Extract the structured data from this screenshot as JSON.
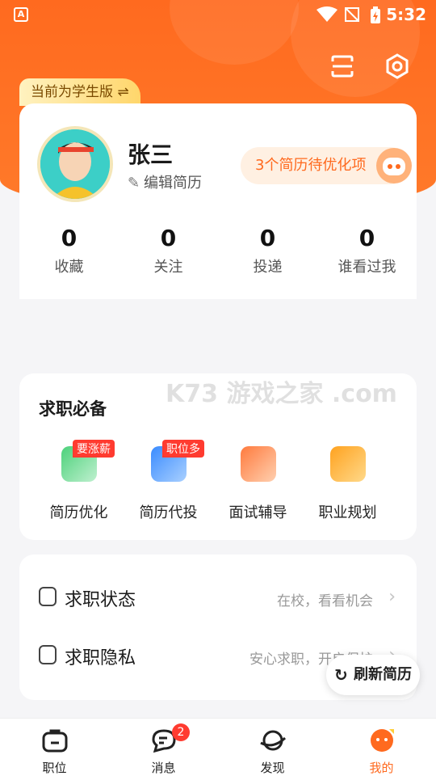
{
  "status_bar": {
    "time": "5:32",
    "app_icon_letter": "A"
  },
  "header": {
    "mode_tag": "当前为学生版 ⇌",
    "scan_icon": "scan-icon",
    "settings_icon": "settings-icon"
  },
  "profile": {
    "name": "张三",
    "edit_label": "编辑简历",
    "optimize_pill": "3个简历待优化项",
    "stats": [
      {
        "value": "0",
        "label": "收藏"
      },
      {
        "value": "0",
        "label": "关注"
      },
      {
        "value": "0",
        "label": "投递"
      },
      {
        "value": "0",
        "label": "谁看过我"
      }
    ]
  },
  "job_essentials": {
    "title": "求职必备",
    "tools": [
      {
        "label": "简历优化",
        "badge": "要涨薪",
        "icon": "resume-edit-icon"
      },
      {
        "label": "简历代投",
        "badge": "职位多",
        "icon": "mail-icon"
      },
      {
        "label": "面试辅导",
        "badge": "",
        "icon": "chat-icon"
      },
      {
        "label": "职业规划",
        "badge": "",
        "icon": "briefcase-icon"
      }
    ]
  },
  "settings": [
    {
      "title": "求职状态",
      "value": "在校，看看机会"
    },
    {
      "title": "求职隐私",
      "value": "安心求职，开启保护"
    }
  ],
  "refresh_button": "刷新简历",
  "watermark": "K73 游戏之家 .com",
  "tabbar": [
    {
      "label": "职位",
      "icon": "briefcase-icon",
      "active": false
    },
    {
      "label": "消息",
      "icon": "message-icon",
      "badge": "2",
      "active": false
    },
    {
      "label": "发现",
      "icon": "planet-icon",
      "active": false
    },
    {
      "label": "我的",
      "icon": "profile-icon",
      "active": true
    }
  ],
  "colors": {
    "brand": "#ff6a1f",
    "badge": "#ff3b30",
    "bg": "#f5f5f7"
  }
}
